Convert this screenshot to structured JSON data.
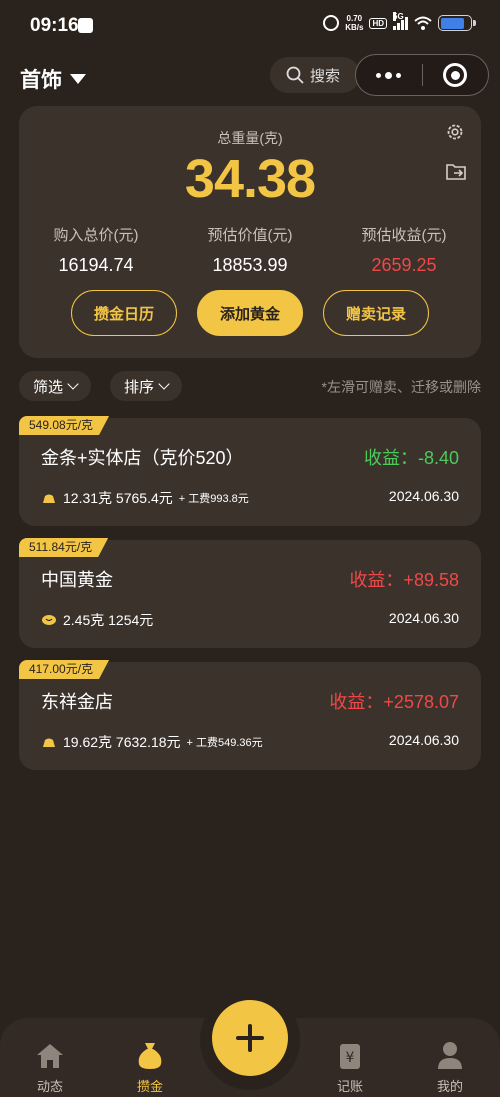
{
  "status_bar": {
    "time": "09:16",
    "net_speed_value": "0.70",
    "net_speed_unit": "KB/s",
    "hd": "HD",
    "signal": "5G",
    "battery_level": 0.8
  },
  "header": {
    "title": "首饰",
    "search_label": "搜索"
  },
  "summary": {
    "total_weight_label": "总重量(克)",
    "total_weight": "34.38",
    "stats": [
      {
        "label": "购入总价(元)",
        "value": "16194.74"
      },
      {
        "label": "预估价值(元)",
        "value": "18853.99"
      },
      {
        "label": "预估收益(元)",
        "value": "2659.25"
      }
    ],
    "buttons": {
      "calendar": "攒金日历",
      "add_gold": "添加黄金",
      "records": "赠卖记录"
    }
  },
  "filters": {
    "filter_label": "筛选",
    "sort_label": "排序",
    "hint": "*左滑可赠卖、迁移或删除"
  },
  "items": [
    {
      "price_tag": "549.08元/克",
      "name": "金条+实体店（克价520）",
      "gain": "收益：-8.40",
      "weight_price": "12.31克 5765.4元",
      "fee": "+ 工费993.8元",
      "date": "2024.06.30"
    },
    {
      "price_tag": "511.84元/克",
      "name": "中国黄金",
      "gain": "收益：+89.58",
      "weight_price": "2.45克 1254元",
      "fee": "",
      "date": "2024.06.30"
    },
    {
      "price_tag": "417.00元/克",
      "name": "东祥金店",
      "gain": "收益：+2578.07",
      "weight_price": "19.62克 7632.18元",
      "fee": "+ 工费549.36元",
      "date": "2024.06.30"
    }
  ],
  "tabs": {
    "dynamic": "动态",
    "save_gold": "攒金",
    "bookkeeping": "记账",
    "mine": "我的"
  },
  "colors": {
    "background": "#2a221d",
    "card": "#3b322c",
    "gold": "#f3c545",
    "gain_positive": "#f04848",
    "gain_negative": "#4ccb5a"
  }
}
